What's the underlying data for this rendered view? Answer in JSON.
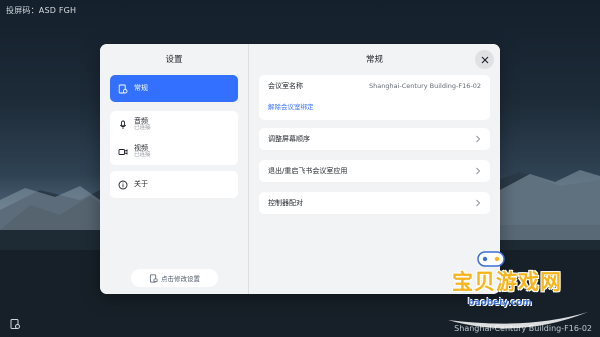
{
  "screen_code": "投屏码：ASD FGH",
  "bottom_caption": "Shanghai-Century Building-F16-02",
  "settings": {
    "left_title": "设置",
    "menu": [
      {
        "label": "常规",
        "sub": "",
        "icon": "settings-doc-icon",
        "active": true
      },
      {
        "label": "音频",
        "sub": "已连接",
        "icon": "microphone-icon",
        "active": false
      },
      {
        "label": "视频",
        "sub": "已连接",
        "icon": "camera-icon",
        "active": false
      },
      {
        "label": "关于",
        "sub": "",
        "icon": "info-icon",
        "active": false
      }
    ],
    "modify_button": "点击修改设置"
  },
  "general": {
    "title": "常规",
    "room_label": "会议室名称",
    "room_value": "Shanghai-Century Building-F16-02",
    "unbind_link": "解除会议室绑定",
    "rows": [
      "调整屏幕顺序",
      "退出/重启飞书会议室应用",
      "控制器配对"
    ]
  },
  "watermark": {
    "title": "宝贝游戏网",
    "url": "baobeiy.com"
  },
  "colors": {
    "accent": "#3370ff",
    "watermark": "#f5b51b"
  }
}
